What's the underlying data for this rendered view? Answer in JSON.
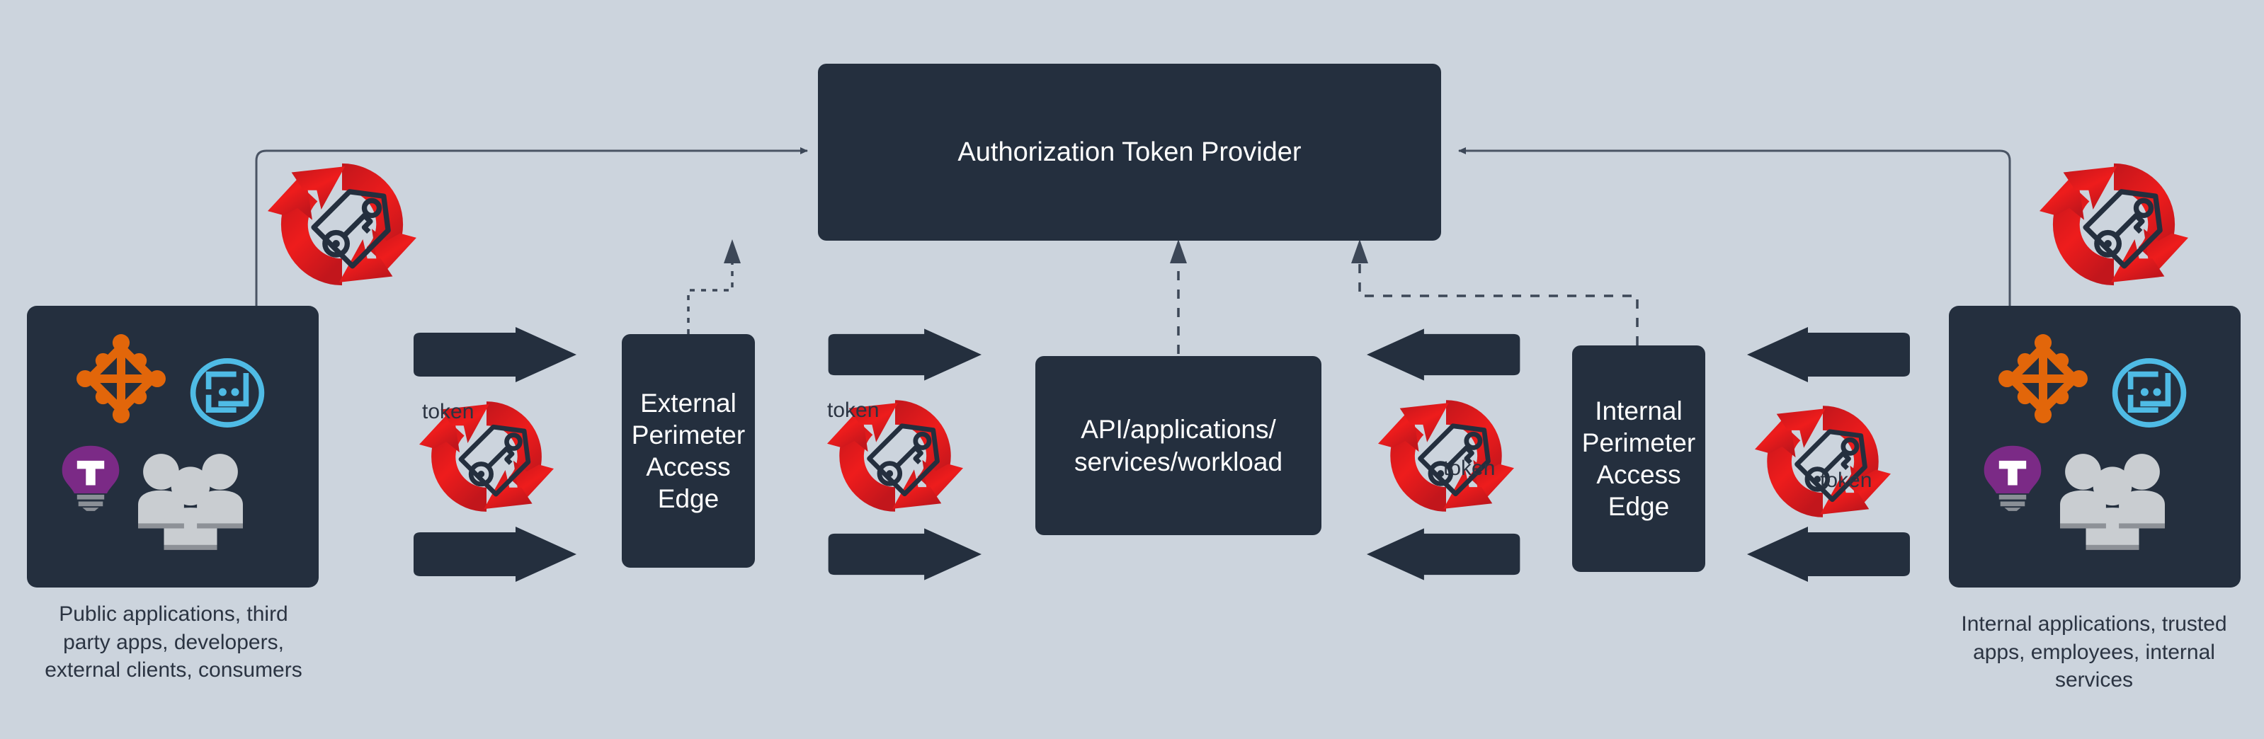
{
  "diagram": {
    "title_node": {
      "label": "Authorization Token Provider"
    },
    "nodes": [
      {
        "id": "external-edge",
        "label": "External\nPerimeter\nAccess\nEdge"
      },
      {
        "id": "api-workload",
        "label": "API/applications/\nservices/workload"
      },
      {
        "id": "internal-edge",
        "label": "Internal\nPerimeter\nAccess\nEdge"
      }
    ],
    "actors": [
      {
        "id": "external-actor",
        "caption": "Public applications, third\nparty apps, developers,\nexternal clients, consumers",
        "icons": [
          "network-nodes-icon",
          "console-window-icon",
          "lightbulb-icon",
          "user-group-icon"
        ]
      },
      {
        "id": "internal-actor",
        "caption": "Internal applications, trusted\napps, employees, internal\nservices",
        "icons": [
          "network-nodes-icon",
          "console-window-icon",
          "lightbulb-icon",
          "user-group-icon"
        ]
      }
    ],
    "token_labels": [
      {
        "id": "token-label-1",
        "text": "token"
      },
      {
        "id": "token-label-2",
        "text": "token"
      },
      {
        "id": "token-label-3",
        "text": "token"
      },
      {
        "id": "token-label-4",
        "text": "token"
      }
    ],
    "token_badges": [
      {
        "id": "token-badge-external-top"
      },
      {
        "id": "token-badge-external-left"
      },
      {
        "id": "token-badge-external-right"
      },
      {
        "id": "token-badge-internal-left"
      },
      {
        "id": "token-badge-internal-right"
      },
      {
        "id": "token-badge-internal-top"
      }
    ],
    "colors": {
      "background": "#ccd4dd",
      "node_fill": "#242f3e",
      "node_text": "#ffffff",
      "caption_text": "#2b3442",
      "token_red": "#e01b1b",
      "token_red_dark": "#b3141a",
      "icon_orange": "#e2660a",
      "icon_cyan": "#4fbbe5",
      "icon_purple": "#7b2a86",
      "icon_gray": "#c9cdd1",
      "edge_line": "#4a5464"
    }
  }
}
